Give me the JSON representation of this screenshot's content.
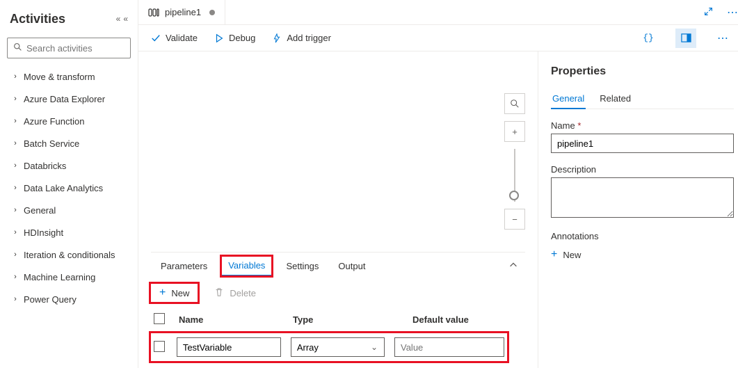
{
  "sidebar": {
    "title": "Activities",
    "search_placeholder": "Search activities",
    "items": [
      {
        "label": "Move & transform"
      },
      {
        "label": "Azure Data Explorer"
      },
      {
        "label": "Azure Function"
      },
      {
        "label": "Batch Service"
      },
      {
        "label": "Databricks"
      },
      {
        "label": "Data Lake Analytics"
      },
      {
        "label": "General"
      },
      {
        "label": "HDInsight"
      },
      {
        "label": "Iteration & conditionals"
      },
      {
        "label": "Machine Learning"
      },
      {
        "label": "Power Query"
      }
    ]
  },
  "tab": {
    "title": "pipeline1"
  },
  "toolbar": {
    "validate": "Validate",
    "debug": "Debug",
    "add_trigger": "Add trigger"
  },
  "bottom_panel": {
    "tabs": {
      "parameters": "Parameters",
      "variables": "Variables",
      "settings": "Settings",
      "output": "Output"
    },
    "new_label": "New",
    "delete_label": "Delete",
    "columns": {
      "name": "Name",
      "type": "Type",
      "default": "Default value"
    },
    "rows": [
      {
        "name": "TestVariable",
        "type": "Array",
        "default_placeholder": "Value"
      }
    ]
  },
  "properties": {
    "title": "Properties",
    "tabs": {
      "general": "General",
      "related": "Related"
    },
    "name_label": "Name",
    "name_value": "pipeline1",
    "description_label": "Description",
    "description_value": "",
    "annotations_label": "Annotations",
    "annotations_new": "New"
  }
}
